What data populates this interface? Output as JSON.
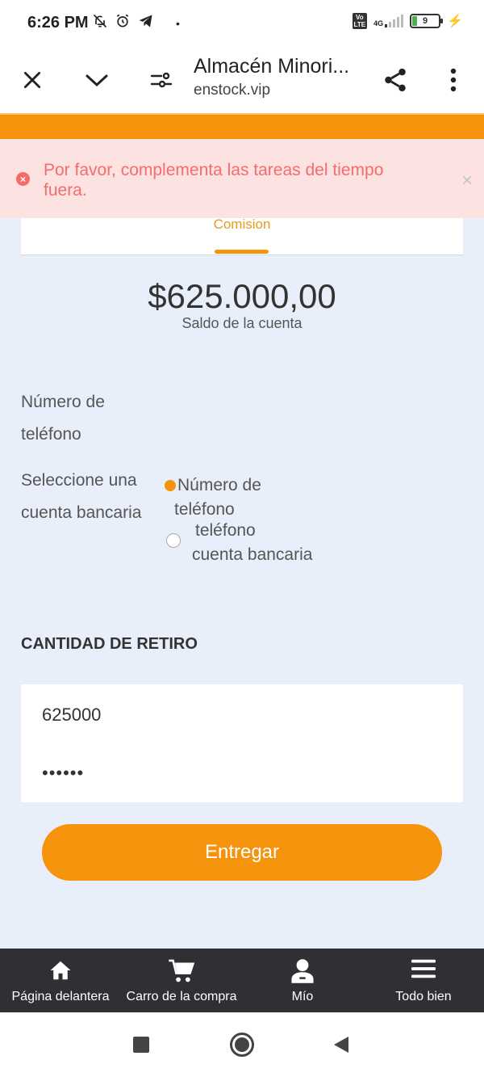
{
  "status_bar": {
    "time": "6:26 PM",
    "network": "4G",
    "battery_level": "9",
    "icons": [
      "bell-off-icon",
      "alarm-icon",
      "telegram-icon",
      "dot-icon"
    ]
  },
  "browser": {
    "title": "Almacén Minori...",
    "url": "enstock.vip",
    "icons": [
      "close-icon",
      "chevron-down-icon",
      "tune-icon",
      "share-icon",
      "more-vert-icon"
    ]
  },
  "toast": {
    "message": "Por favor, complementa las tareas del tiempo fuera.",
    "close_symbol": "×"
  },
  "tabs": {
    "active_label": "Comision"
  },
  "balance": {
    "amount": "$625.000,00",
    "label": "Saldo de la cuenta"
  },
  "form": {
    "phone_label_line1": "Número de",
    "phone_label_line2": "teléfono",
    "bank_label_line1": "Seleccione una",
    "bank_label_line2": "cuenta bancaria",
    "option1_line1": "Número de",
    "option1_line2": "teléfono",
    "option2_line1": "teléfono",
    "option2_line2": "cuenta bancaria",
    "option1_selected": true,
    "section_heading": "CANTIDAD DE RETIRO",
    "amount_value": "625000",
    "password_value": "••••••",
    "submit_label": "Entregar"
  },
  "bottom_nav": [
    {
      "label": "Página delantera",
      "icon": "home-icon"
    },
    {
      "label": "Carro de la compra",
      "icon": "cart-icon"
    },
    {
      "label": "Mío",
      "icon": "user-icon"
    },
    {
      "label": "Todo bien",
      "icon": "menu-icon"
    }
  ],
  "colors": {
    "accent": "#f5930d",
    "toast_text": "#f56c6c",
    "toast_bg": "#fde2e2",
    "main_bg": "#e8effa",
    "nav_bg": "#2e3033"
  }
}
